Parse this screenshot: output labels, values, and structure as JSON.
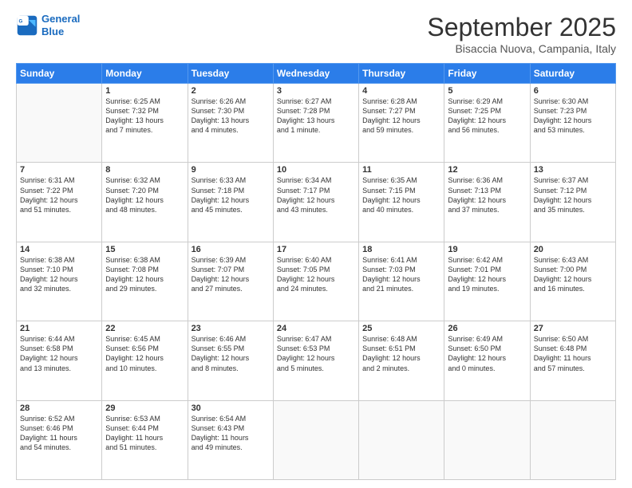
{
  "logo": {
    "line1": "General",
    "line2": "Blue"
  },
  "title": "September 2025",
  "subtitle": "Bisaccia Nuova, Campania, Italy",
  "days_header": [
    "Sunday",
    "Monday",
    "Tuesday",
    "Wednesday",
    "Thursday",
    "Friday",
    "Saturday"
  ],
  "weeks": [
    [
      {
        "day": "",
        "info": ""
      },
      {
        "day": "1",
        "info": "Sunrise: 6:25 AM\nSunset: 7:32 PM\nDaylight: 13 hours\nand 7 minutes."
      },
      {
        "day": "2",
        "info": "Sunrise: 6:26 AM\nSunset: 7:30 PM\nDaylight: 13 hours\nand 4 minutes."
      },
      {
        "day": "3",
        "info": "Sunrise: 6:27 AM\nSunset: 7:28 PM\nDaylight: 13 hours\nand 1 minute."
      },
      {
        "day": "4",
        "info": "Sunrise: 6:28 AM\nSunset: 7:27 PM\nDaylight: 12 hours\nand 59 minutes."
      },
      {
        "day": "5",
        "info": "Sunrise: 6:29 AM\nSunset: 7:25 PM\nDaylight: 12 hours\nand 56 minutes."
      },
      {
        "day": "6",
        "info": "Sunrise: 6:30 AM\nSunset: 7:23 PM\nDaylight: 12 hours\nand 53 minutes."
      }
    ],
    [
      {
        "day": "7",
        "info": "Sunrise: 6:31 AM\nSunset: 7:22 PM\nDaylight: 12 hours\nand 51 minutes."
      },
      {
        "day": "8",
        "info": "Sunrise: 6:32 AM\nSunset: 7:20 PM\nDaylight: 12 hours\nand 48 minutes."
      },
      {
        "day": "9",
        "info": "Sunrise: 6:33 AM\nSunset: 7:18 PM\nDaylight: 12 hours\nand 45 minutes."
      },
      {
        "day": "10",
        "info": "Sunrise: 6:34 AM\nSunset: 7:17 PM\nDaylight: 12 hours\nand 43 minutes."
      },
      {
        "day": "11",
        "info": "Sunrise: 6:35 AM\nSunset: 7:15 PM\nDaylight: 12 hours\nand 40 minutes."
      },
      {
        "day": "12",
        "info": "Sunrise: 6:36 AM\nSunset: 7:13 PM\nDaylight: 12 hours\nand 37 minutes."
      },
      {
        "day": "13",
        "info": "Sunrise: 6:37 AM\nSunset: 7:12 PM\nDaylight: 12 hours\nand 35 minutes."
      }
    ],
    [
      {
        "day": "14",
        "info": "Sunrise: 6:38 AM\nSunset: 7:10 PM\nDaylight: 12 hours\nand 32 minutes."
      },
      {
        "day": "15",
        "info": "Sunrise: 6:38 AM\nSunset: 7:08 PM\nDaylight: 12 hours\nand 29 minutes."
      },
      {
        "day": "16",
        "info": "Sunrise: 6:39 AM\nSunset: 7:07 PM\nDaylight: 12 hours\nand 27 minutes."
      },
      {
        "day": "17",
        "info": "Sunrise: 6:40 AM\nSunset: 7:05 PM\nDaylight: 12 hours\nand 24 minutes."
      },
      {
        "day": "18",
        "info": "Sunrise: 6:41 AM\nSunset: 7:03 PM\nDaylight: 12 hours\nand 21 minutes."
      },
      {
        "day": "19",
        "info": "Sunrise: 6:42 AM\nSunset: 7:01 PM\nDaylight: 12 hours\nand 19 minutes."
      },
      {
        "day": "20",
        "info": "Sunrise: 6:43 AM\nSunset: 7:00 PM\nDaylight: 12 hours\nand 16 minutes."
      }
    ],
    [
      {
        "day": "21",
        "info": "Sunrise: 6:44 AM\nSunset: 6:58 PM\nDaylight: 12 hours\nand 13 minutes."
      },
      {
        "day": "22",
        "info": "Sunrise: 6:45 AM\nSunset: 6:56 PM\nDaylight: 12 hours\nand 10 minutes."
      },
      {
        "day": "23",
        "info": "Sunrise: 6:46 AM\nSunset: 6:55 PM\nDaylight: 12 hours\nand 8 minutes."
      },
      {
        "day": "24",
        "info": "Sunrise: 6:47 AM\nSunset: 6:53 PM\nDaylight: 12 hours\nand 5 minutes."
      },
      {
        "day": "25",
        "info": "Sunrise: 6:48 AM\nSunset: 6:51 PM\nDaylight: 12 hours\nand 2 minutes."
      },
      {
        "day": "26",
        "info": "Sunrise: 6:49 AM\nSunset: 6:50 PM\nDaylight: 12 hours\nand 0 minutes."
      },
      {
        "day": "27",
        "info": "Sunrise: 6:50 AM\nSunset: 6:48 PM\nDaylight: 11 hours\nand 57 minutes."
      }
    ],
    [
      {
        "day": "28",
        "info": "Sunrise: 6:52 AM\nSunset: 6:46 PM\nDaylight: 11 hours\nand 54 minutes."
      },
      {
        "day": "29",
        "info": "Sunrise: 6:53 AM\nSunset: 6:44 PM\nDaylight: 11 hours\nand 51 minutes."
      },
      {
        "day": "30",
        "info": "Sunrise: 6:54 AM\nSunset: 6:43 PM\nDaylight: 11 hours\nand 49 minutes."
      },
      {
        "day": "",
        "info": ""
      },
      {
        "day": "",
        "info": ""
      },
      {
        "day": "",
        "info": ""
      },
      {
        "day": "",
        "info": ""
      }
    ]
  ]
}
